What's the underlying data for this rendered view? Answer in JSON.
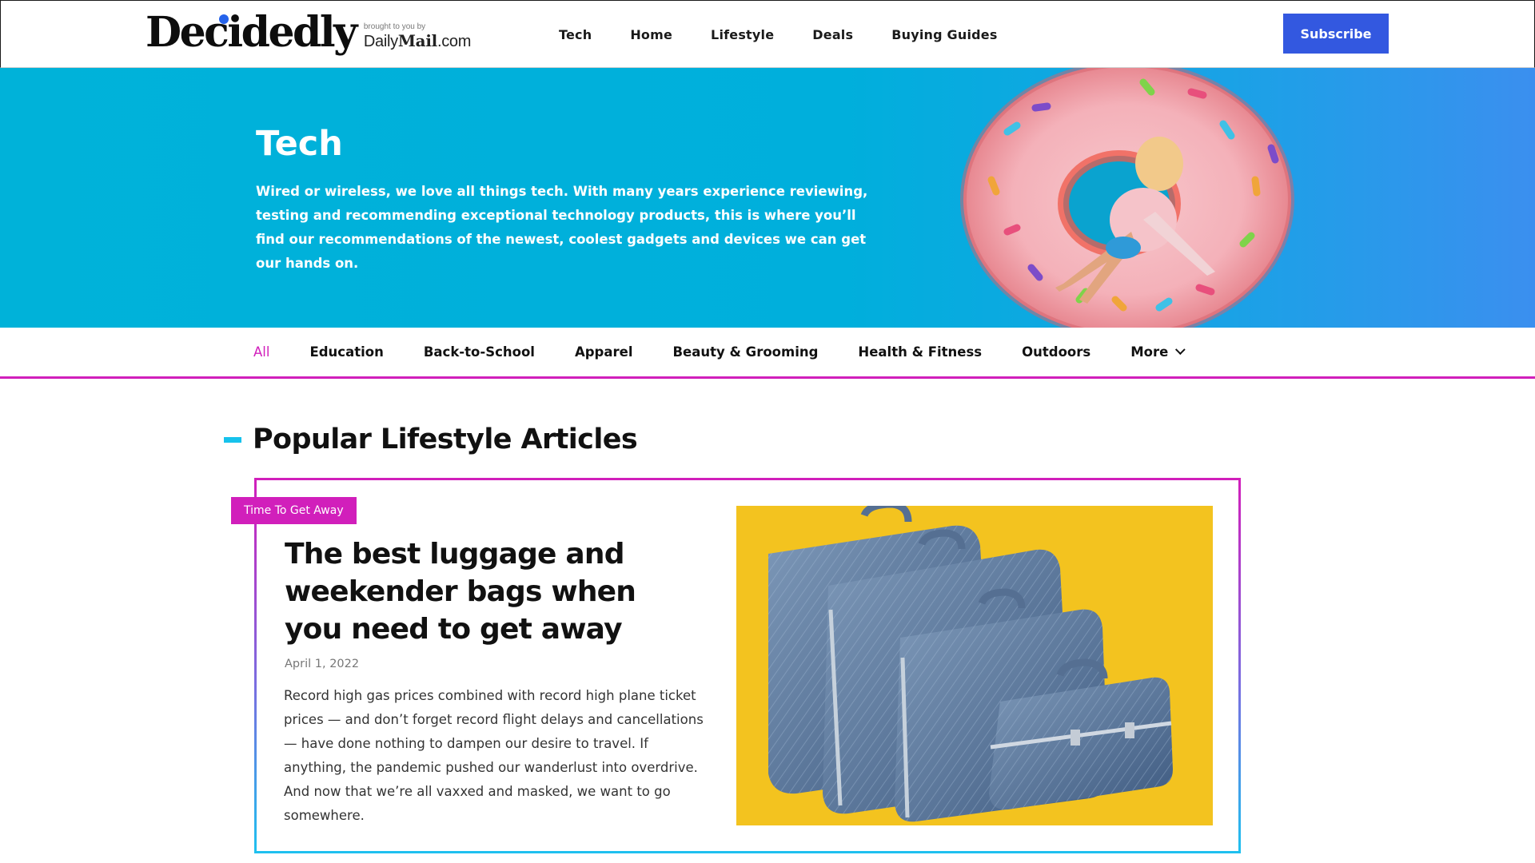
{
  "header": {
    "logo_word": "Decidedly",
    "logo_small": "brought to you by",
    "logo_brand_a": "Daily",
    "logo_brand_b": "Mail",
    "logo_brand_c": ".com",
    "nav": [
      "Tech",
      "Home",
      "Lifestyle",
      "Deals",
      "Buying Guides"
    ],
    "subscribe_label": "Subscribe"
  },
  "hero": {
    "title": "Tech",
    "description": "Wired or wireless, we love all things tech. With many years experience reviewing, testing and recommending exceptional technology products, this is where you’ll find our recommendations of the newest, coolest gadgets and devices we can get our hands on."
  },
  "tabs": {
    "items": [
      "All",
      "Education",
      "Back-to-School",
      "Apparel",
      "Beauty & Grooming",
      "Health & Fitness",
      "Outdoors",
      "More"
    ],
    "active": "All"
  },
  "section": {
    "title": "Popular Lifestyle Articles"
  },
  "article": {
    "badge": "Time To Get Away",
    "title": "The best luggage and weekender bags when you need to get away",
    "date": "April 1, 2022",
    "excerpt": "Record high gas prices combined with record high plane ticket prices — and don’t forget record flight delays and cancellations — have done nothing to dampen our desire to travel. If anything, the pandemic pushed our wanderlust into overdrive. And now that we’re all vaxxed and masked, we want to go somewhere."
  },
  "colors": {
    "accent_blue": "#3358e0",
    "accent_magenta": "#d11fbb",
    "hero_cyan": "#00b2d9",
    "section_dash": "#16c2ec"
  },
  "icons": {
    "more_chevron": "chevron-down-icon"
  }
}
